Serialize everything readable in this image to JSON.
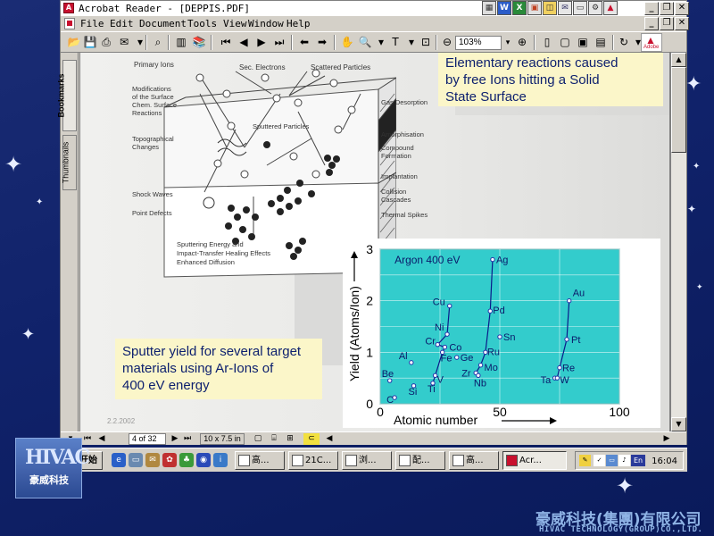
{
  "window": {
    "title": "Acrobat Reader - [DEPPIS.PDF]",
    "menu": [
      "File",
      "Edit",
      "Document",
      "Tools",
      "View",
      "Window",
      "Help"
    ],
    "zoom": "103%",
    "adobe_logo": "Adobe"
  },
  "nav_tabs": [
    "Bookmarks",
    "Thumbnails"
  ],
  "slide": {
    "callout_top": [
      "Elementary reactions caused",
      "by free Ions hitting a Solid",
      "State Surface"
    ],
    "callout_bottom": [
      "Sputter yield for several target",
      "materials using Ar-Ions of",
      "400 eV energy"
    ],
    "date": "2.2.2002",
    "diagram": {
      "top_labels": [
        "Primary Ions",
        "Sec. Electrons",
        "Scattered Particles"
      ],
      "left_labels": [
        "Modifications",
        "of the Surface",
        "Chem. Surface",
        "Reactions"
      ],
      "topographical": [
        "Topographical",
        "Changes"
      ],
      "shock": "Shock Waves",
      "point_defects": "Point Defects",
      "sputtered": "Sputtered Particles",
      "right_labels": [
        "Gas Desorption",
        "Amorphisation",
        "Compound",
        "Formation",
        "Implantation",
        "Collision",
        "Cascades",
        "Thermal Spikes"
      ],
      "bottom_text": [
        "Sputtering Energy and",
        "Impact-Transfer Healing Effects",
        "Enhanced Diffusion"
      ]
    }
  },
  "chart_data": {
    "type": "scatter",
    "title": "Argon 400 eV",
    "xlabel": "Atomic number",
    "ylabel": "Yield (Atoms/Ion)",
    "xlim": [
      0,
      100
    ],
    "ylim": [
      0,
      3
    ],
    "xticks": [
      "0",
      "50",
      "100"
    ],
    "yticks": [
      "0",
      "1",
      "2",
      "3"
    ],
    "grid": true,
    "background": "#33cccc",
    "points": [
      {
        "label": "Be",
        "x": 4,
        "y": 0.45
      },
      {
        "label": "C",
        "x": 6,
        "y": 0.12
      },
      {
        "label": "Al",
        "x": 13,
        "y": 0.8
      },
      {
        "label": "Si",
        "x": 14,
        "y": 0.35
      },
      {
        "label": "Ti",
        "x": 22,
        "y": 0.4
      },
      {
        "label": "V",
        "x": 23,
        "y": 0.55
      },
      {
        "label": "Cr",
        "x": 24,
        "y": 1.15
      },
      {
        "label": "Fe",
        "x": 26,
        "y": 1.0
      },
      {
        "label": "Co",
        "x": 27,
        "y": 1.1
      },
      {
        "label": "Ni",
        "x": 28,
        "y": 1.35
      },
      {
        "label": "Cu",
        "x": 29,
        "y": 1.9
      },
      {
        "label": "Ge",
        "x": 32,
        "y": 0.9
      },
      {
        "label": "Zr",
        "x": 40,
        "y": 0.6
      },
      {
        "label": "Nb",
        "x": 41,
        "y": 0.55
      },
      {
        "label": "Mo",
        "x": 42,
        "y": 0.75
      },
      {
        "label": "Ru",
        "x": 44,
        "y": 1.0
      },
      {
        "label": "Pd",
        "x": 46,
        "y": 1.8
      },
      {
        "label": "Ag",
        "x": 47,
        "y": 2.8
      },
      {
        "label": "Sn",
        "x": 50,
        "y": 1.3
      },
      {
        "label": "Ta",
        "x": 73,
        "y": 0.5
      },
      {
        "label": "W",
        "x": 74,
        "y": 0.5
      },
      {
        "label": "Re",
        "x": 75,
        "y": 0.7
      },
      {
        "label": "Pt",
        "x": 78,
        "y": 1.25
      },
      {
        "label": "Au",
        "x": 79,
        "y": 2.0
      }
    ],
    "connected_groups": [
      [
        "Ti",
        "V",
        "Cr",
        "Fe",
        "Co",
        "Ni",
        "Cu"
      ],
      [
        "Zr",
        "Nb",
        "Mo",
        "Ru",
        "Pd",
        "Ag"
      ],
      [
        "Ta",
        "W",
        "Re",
        "Pt",
        "Au"
      ]
    ]
  },
  "status": {
    "page": "4 of 32",
    "size": "10 x 7.5 in"
  },
  "taskbar": {
    "start": "开始",
    "tasks": [
      "高...",
      "21C...",
      "浏...",
      "配...",
      "高...",
      "Acr..."
    ],
    "clock": "16:04",
    "lang": "En"
  },
  "branding": {
    "logo_mark": "HIVAC",
    "logo_text": "豪威科技",
    "company_cn": "豪威科技(集團)有限公司",
    "company_en": "HIVAC TECHNOLOGY(GROUP)CO.,LTD."
  }
}
